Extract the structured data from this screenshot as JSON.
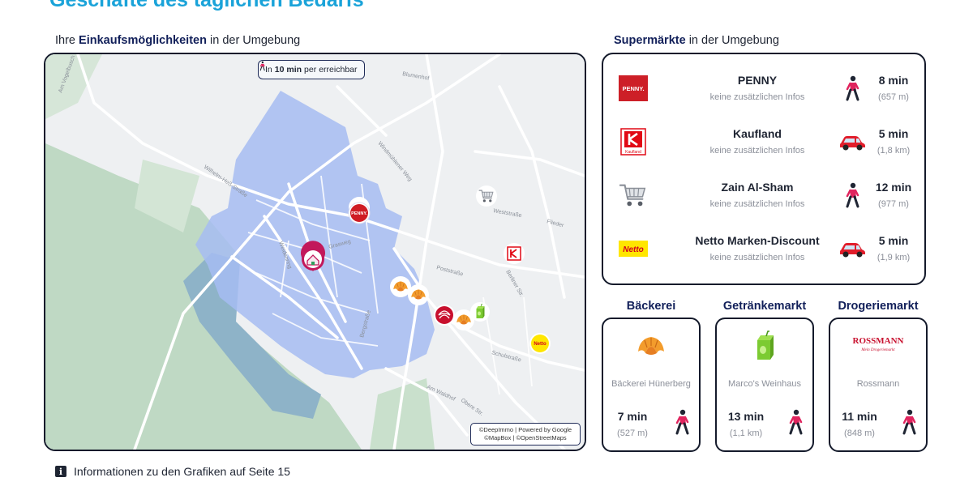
{
  "page": {
    "title": "Geschäfte des täglichen Bedarfs",
    "footnote": "Informationen zu den Grafiken auf Seite 15"
  },
  "map_section": {
    "heading_prefix": "Ihre",
    "heading_bold": "Einkaufsmöglichkeiten",
    "heading_suffix": "in der Umgebung",
    "badge_prefix": "In",
    "badge_time": "10 min",
    "badge_mid": "per",
    "badge_suffix": "erreichbar",
    "badge_icon": "walking-person-icon",
    "attribution_line1": "©DeepImmo | Powered by Google",
    "attribution_line2": "©MapBox | ©OpenStreetMaps",
    "street_labels": [
      "Am Vogelbusch",
      "Wilhelm-Heß-Straße",
      "Grasweg",
      "Weidenring",
      "Poststraße",
      "Bergstraße",
      "Schulstraße",
      "Berliner Str.",
      "Am Waldhof",
      "Obere Str.",
      "Blumenhof",
      "Windmühlener Weg",
      "Flieder",
      "Weststraße"
    ],
    "pins": [
      {
        "name": "penny-pin",
        "icon": "penny-logo"
      },
      {
        "name": "home-pin",
        "icon": "home-icon"
      },
      {
        "name": "bakery-pin-1",
        "icon": "croissant-icon"
      },
      {
        "name": "bakery-pin-2",
        "icon": "croissant-icon"
      },
      {
        "name": "bakery-pin-3",
        "icon": "croissant-icon"
      },
      {
        "name": "rossmann-pin",
        "icon": "rossmann-logo"
      },
      {
        "name": "drink-pin",
        "icon": "drink-carton-icon"
      },
      {
        "name": "kaufland-pin",
        "icon": "kaufland-logo"
      },
      {
        "name": "cart-pin",
        "icon": "shopping-cart-icon"
      },
      {
        "name": "netto-pin",
        "icon": "netto-logo"
      }
    ],
    "colors": {
      "catchment": "#9fb6f0",
      "forest": "#b9d7c0",
      "water": "#8fb6cf"
    }
  },
  "supermarkets": {
    "heading_bold": "Supermärkte",
    "heading_suffix": "in der Umgebung",
    "items": [
      {
        "logo": "penny-logo",
        "logo_text": "PENNY.",
        "name": "PENNY",
        "info": "keine zusätzlichen Infos",
        "mode": "walking-person-icon",
        "time": "8 min",
        "distance": "(657 m)"
      },
      {
        "logo": "kaufland-logo",
        "logo_text": "Kaufland",
        "name": "Kaufland",
        "info": "keine zusätzlichen Infos",
        "mode": "car-icon",
        "time": "5 min",
        "distance": "(1,8 km)"
      },
      {
        "logo": "shopping-cart-icon",
        "logo_text": "",
        "name": "Zain Al-Sham",
        "info": "keine zusätzlichen Infos",
        "mode": "walking-person-icon",
        "time": "12 min",
        "distance": "(977 m)"
      },
      {
        "logo": "netto-logo",
        "logo_text": "Netto",
        "name": "Netto Marken-Discount",
        "info": "keine zusätzlichen Infos",
        "mode": "car-icon",
        "time": "5 min",
        "distance": "(1,9 km)"
      }
    ]
  },
  "categories": [
    {
      "title": "Bäckerei",
      "icon": "croissant-icon",
      "name": "Bäckerei Hünerberg",
      "time": "7 min",
      "distance": "(527 m)",
      "mode": "walking-person-icon"
    },
    {
      "title": "Getränkemarkt",
      "icon": "drink-carton-icon",
      "name": "Marco's Weinhaus",
      "time": "13 min",
      "distance": "(1,1 km)",
      "mode": "walking-person-icon"
    },
    {
      "title": "Drogeriemarkt",
      "icon": "rossmann-logo",
      "logo_text": "ROSSMANN",
      "logo_subtext": "Mein Drogeriemarkt",
      "name": "Rossmann",
      "time": "11 min",
      "distance": "(848 m)",
      "mode": "walking-person-icon"
    }
  ]
}
